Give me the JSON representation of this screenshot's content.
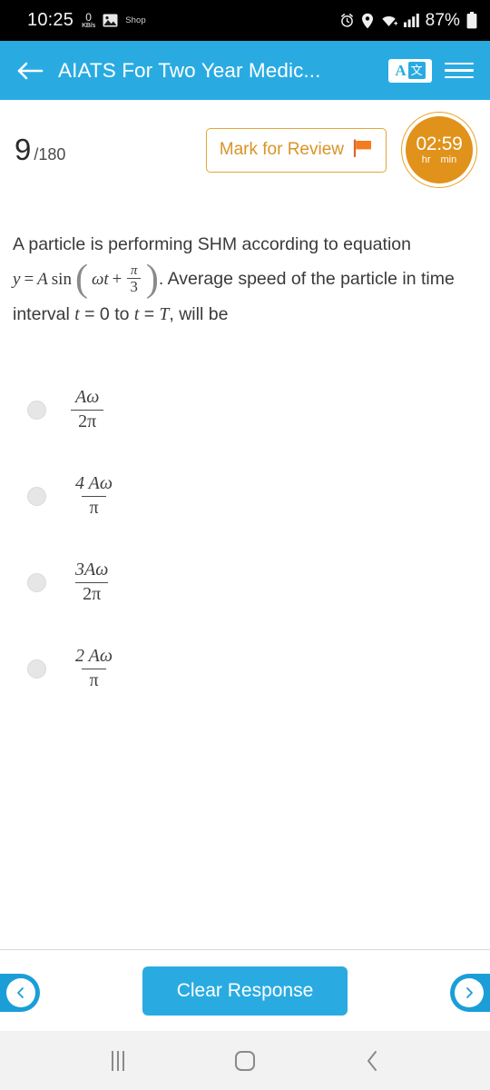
{
  "status_bar": {
    "clock": "10:25",
    "net_speed_value": "0",
    "net_speed_unit": "KB/s",
    "app_label": "Shop",
    "battery_percent": "87%",
    "icons": [
      "gallery-icon",
      "alarm-icon",
      "location-icon",
      "wifi-icon",
      "signal-icon",
      "battery-icon"
    ]
  },
  "app_bar": {
    "title": "AIATS For Two Year Medic...",
    "back_icon": "back-arrow-icon",
    "translate_a": "A",
    "translate_cjk": "文",
    "menu_icon": "hamburger-menu-icon"
  },
  "question_header": {
    "number": "9",
    "total": "/180",
    "mark_for_review_label": "Mark for Review",
    "flag_icon": "flag-icon",
    "timer": {
      "time": "02:59",
      "unit_hours": "hr",
      "unit_minutes": "min"
    }
  },
  "question": {
    "line1": "A particle is performing SHM according to equation",
    "equation": {
      "lhs": "y",
      "equals": "=",
      "amplitude": "A",
      "func": "sin",
      "arg_first": "ωt",
      "plus": "+",
      "frac_num": "π",
      "frac_den": "3"
    },
    "line2_tail": ". Average speed of the particle in time",
    "line3_a": "interval ",
    "line3_t1": "t",
    "line3_b": " = 0 to ",
    "line3_t2": "t",
    "line3_c": " = ",
    "line3_T": "T",
    "line3_d": ", will be"
  },
  "options": [
    {
      "numerator": "Aω",
      "denominator": "2π",
      "selected": false
    },
    {
      "numerator": "4 Aω",
      "denominator": "π",
      "selected": false
    },
    {
      "numerator": "3Aω",
      "denominator": "2π",
      "selected": false
    },
    {
      "numerator": "2 Aω",
      "denominator": "π",
      "selected": false
    }
  ],
  "bottom_bar": {
    "prev_icon": "chevron-left-icon",
    "next_icon": "chevron-right-icon",
    "clear_response_label": "Clear Response"
  },
  "nav_bar": {
    "recents_icon": "recents-icon",
    "home_icon": "home-icon",
    "back_icon": "system-back-icon"
  },
  "colors": {
    "accent_blue": "#29abe2",
    "timer_orange": "#e0921a",
    "mark_review_orange": "#d99427",
    "flag_orange": "#f47b20"
  }
}
